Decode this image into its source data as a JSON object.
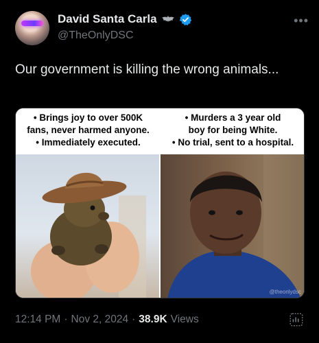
{
  "author": {
    "display_name": "David Santa Carla",
    "handle": "@TheOnlyDSC",
    "verified": true,
    "badge_icon": "bat-icon"
  },
  "tweet": {
    "text": "Our government is killing the wrong animals..."
  },
  "media": {
    "left_caption": [
      "• Brings joy to over 500K",
      "fans, never harmed anyone.",
      "• Immediately executed."
    ],
    "right_caption": [
      "• Murders a 3 year old",
      "boy for being White.",
      "• No trial, sent to a hospital."
    ],
    "watermark": "@theonlydsc"
  },
  "meta": {
    "time": "12:14 PM",
    "date": "Nov 2, 2024",
    "views_count": "38.9K",
    "views_label": "Views",
    "separator": "·"
  },
  "colors": {
    "background": "#000000",
    "text": "#e7e9ea",
    "muted": "#71767b",
    "verified": "#1d9bf0"
  }
}
